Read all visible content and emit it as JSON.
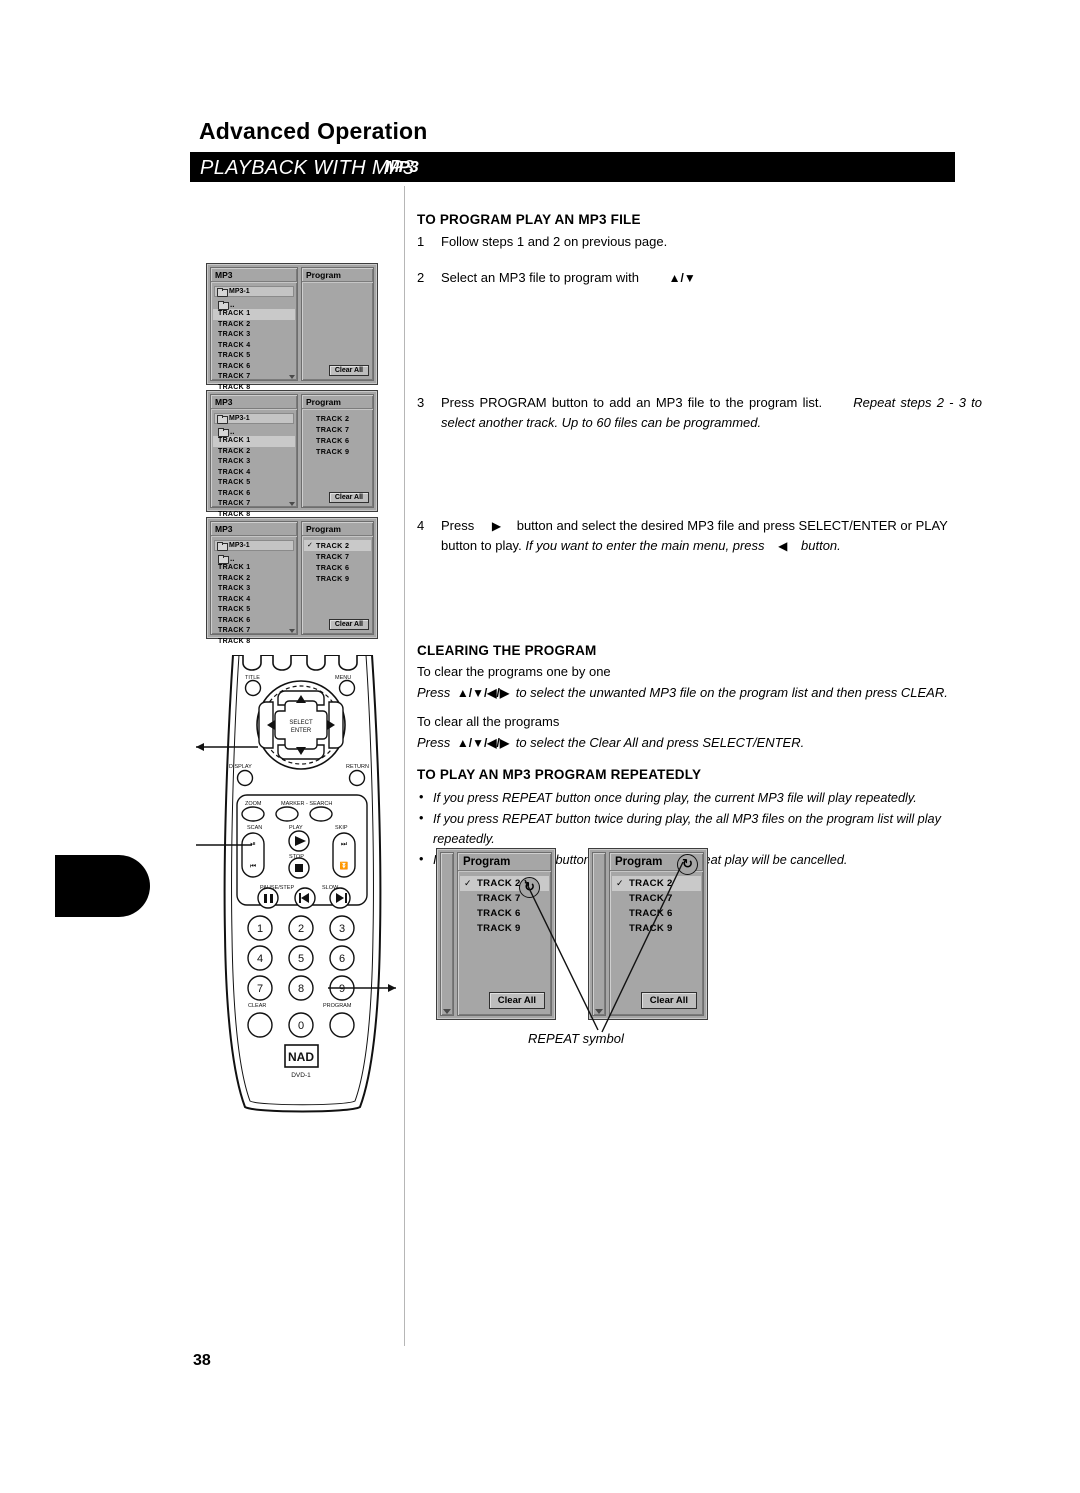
{
  "page": {
    "section_title": "Advanced Operation",
    "band_title": "PLAYBACK WITH MP3",
    "band_logo": "MP3",
    "page_number": "38"
  },
  "content": {
    "heading1": "TO PROGRAM PLAY AN MP3 FILE",
    "step1_num": "1",
    "step1_text": "Follow steps 1 and 2 on previous page.",
    "step2_num": "2",
    "step2_text": "Select an MP3 file to program with",
    "step2_arrows": "▲/▼",
    "step3_num": "3",
    "step3_text": "Press PROGRAM button to add an MP3 file to the program list.",
    "step3_italic": "Repeat steps 2 - 3 to select another track. Up to 60 files can be programmed.",
    "step4_num": "4",
    "step4_pre": "Press",
    "step4_arrow_right": "▶",
    "step4_mid": "button and select the desired MP3 file and press SELECT/ENTER or PLAY button to play.",
    "step4_italic_a": "If you want to enter the main menu, press",
    "step4_arrow_left": "◀",
    "step4_italic_b": "button.",
    "heading2": "CLEARING THE PROGRAM",
    "clear_one_label": "To clear the programs one by one",
    "clear_one_press": "Press",
    "clear_arrows": "▲/▼/◀/▶",
    "clear_one_rest": "to select the unwanted MP3 file on the program list and then press CLEAR.",
    "clear_all_label": "To clear all the programs",
    "clear_all_rest": "to select the Clear All and press SELECT/ENTER.",
    "heading3": "TO PLAY AN MP3 PROGRAM REPEATEDLY",
    "bullets": [
      "If you press REPEAT button once during play, the current MP3 file will play repeatedly.",
      "If you press REPEAT button twice during play, the all MP3 files on the program list will play repeatedly.",
      "If you press REPEAT button three times, the repeat play will be cancelled."
    ],
    "repeat_caption": "REPEAT symbol"
  },
  "osd": {
    "mp3_header": "MP3",
    "program_header": "Program",
    "disc_label": "MP3-1",
    "up_dir": "..",
    "clear_all_button": "Clear All",
    "repeat_glyph": "↻",
    "file_list": [
      "TRACK 1",
      "TRACK 2",
      "TRACK 3",
      "TRACK 4",
      "TRACK 5",
      "TRACK 6",
      "TRACK 7",
      "TRACK 8"
    ],
    "file_selected_index": 0,
    "check_glyph": "✓",
    "screens": [
      {
        "name": "screen-1",
        "program_list": [],
        "program_selected_index": -1,
        "checked_index": -1
      },
      {
        "name": "screen-2",
        "program_list": [
          "TRACK 2",
          "TRACK 7",
          "TRACK 6",
          "TRACK 9"
        ],
        "program_selected_index": -1,
        "checked_index": -1
      },
      {
        "name": "screen-3",
        "program_list": [
          "TRACK 2",
          "TRACK 7",
          "TRACK 6",
          "TRACK 9"
        ],
        "program_selected_index": 0,
        "checked_index": 0
      }
    ],
    "repeat_screens": [
      {
        "name": "repeat-screen-current",
        "program_list": [
          "TRACK 2",
          "TRACK 7",
          "TRACK 6",
          "TRACK 9"
        ],
        "program_selected_index": 0,
        "checked_index": 0
      },
      {
        "name": "repeat-screen-all",
        "program_list": [
          "TRACK 2",
          "TRACK 7",
          "TRACK 6",
          "TRACK 9"
        ],
        "program_selected_index": 0,
        "checked_index": 0
      }
    ]
  },
  "remote": {
    "brand": "NAD",
    "model": "DVD-1",
    "labels": {
      "title": "TITLE",
      "menu": "MENU",
      "display": "DISPLAY",
      "return": "RETURN",
      "select_enter_line1": "SELECT",
      "select_enter_line2": "ENTER",
      "zoom": "ZOOM",
      "marker_search": "MARKER - SEARCH",
      "scan": "SCAN",
      "play": "PLAY",
      "skip": "SKIP",
      "stop": "STOP",
      "pause_step": "PAUSE/STEP",
      "slow": "SLOW",
      "clear": "CLEAR",
      "program": "PROGRAM"
    },
    "keypad": [
      "1",
      "2",
      "3",
      "4",
      "5",
      "6",
      "7",
      "8",
      "9",
      "0"
    ]
  }
}
